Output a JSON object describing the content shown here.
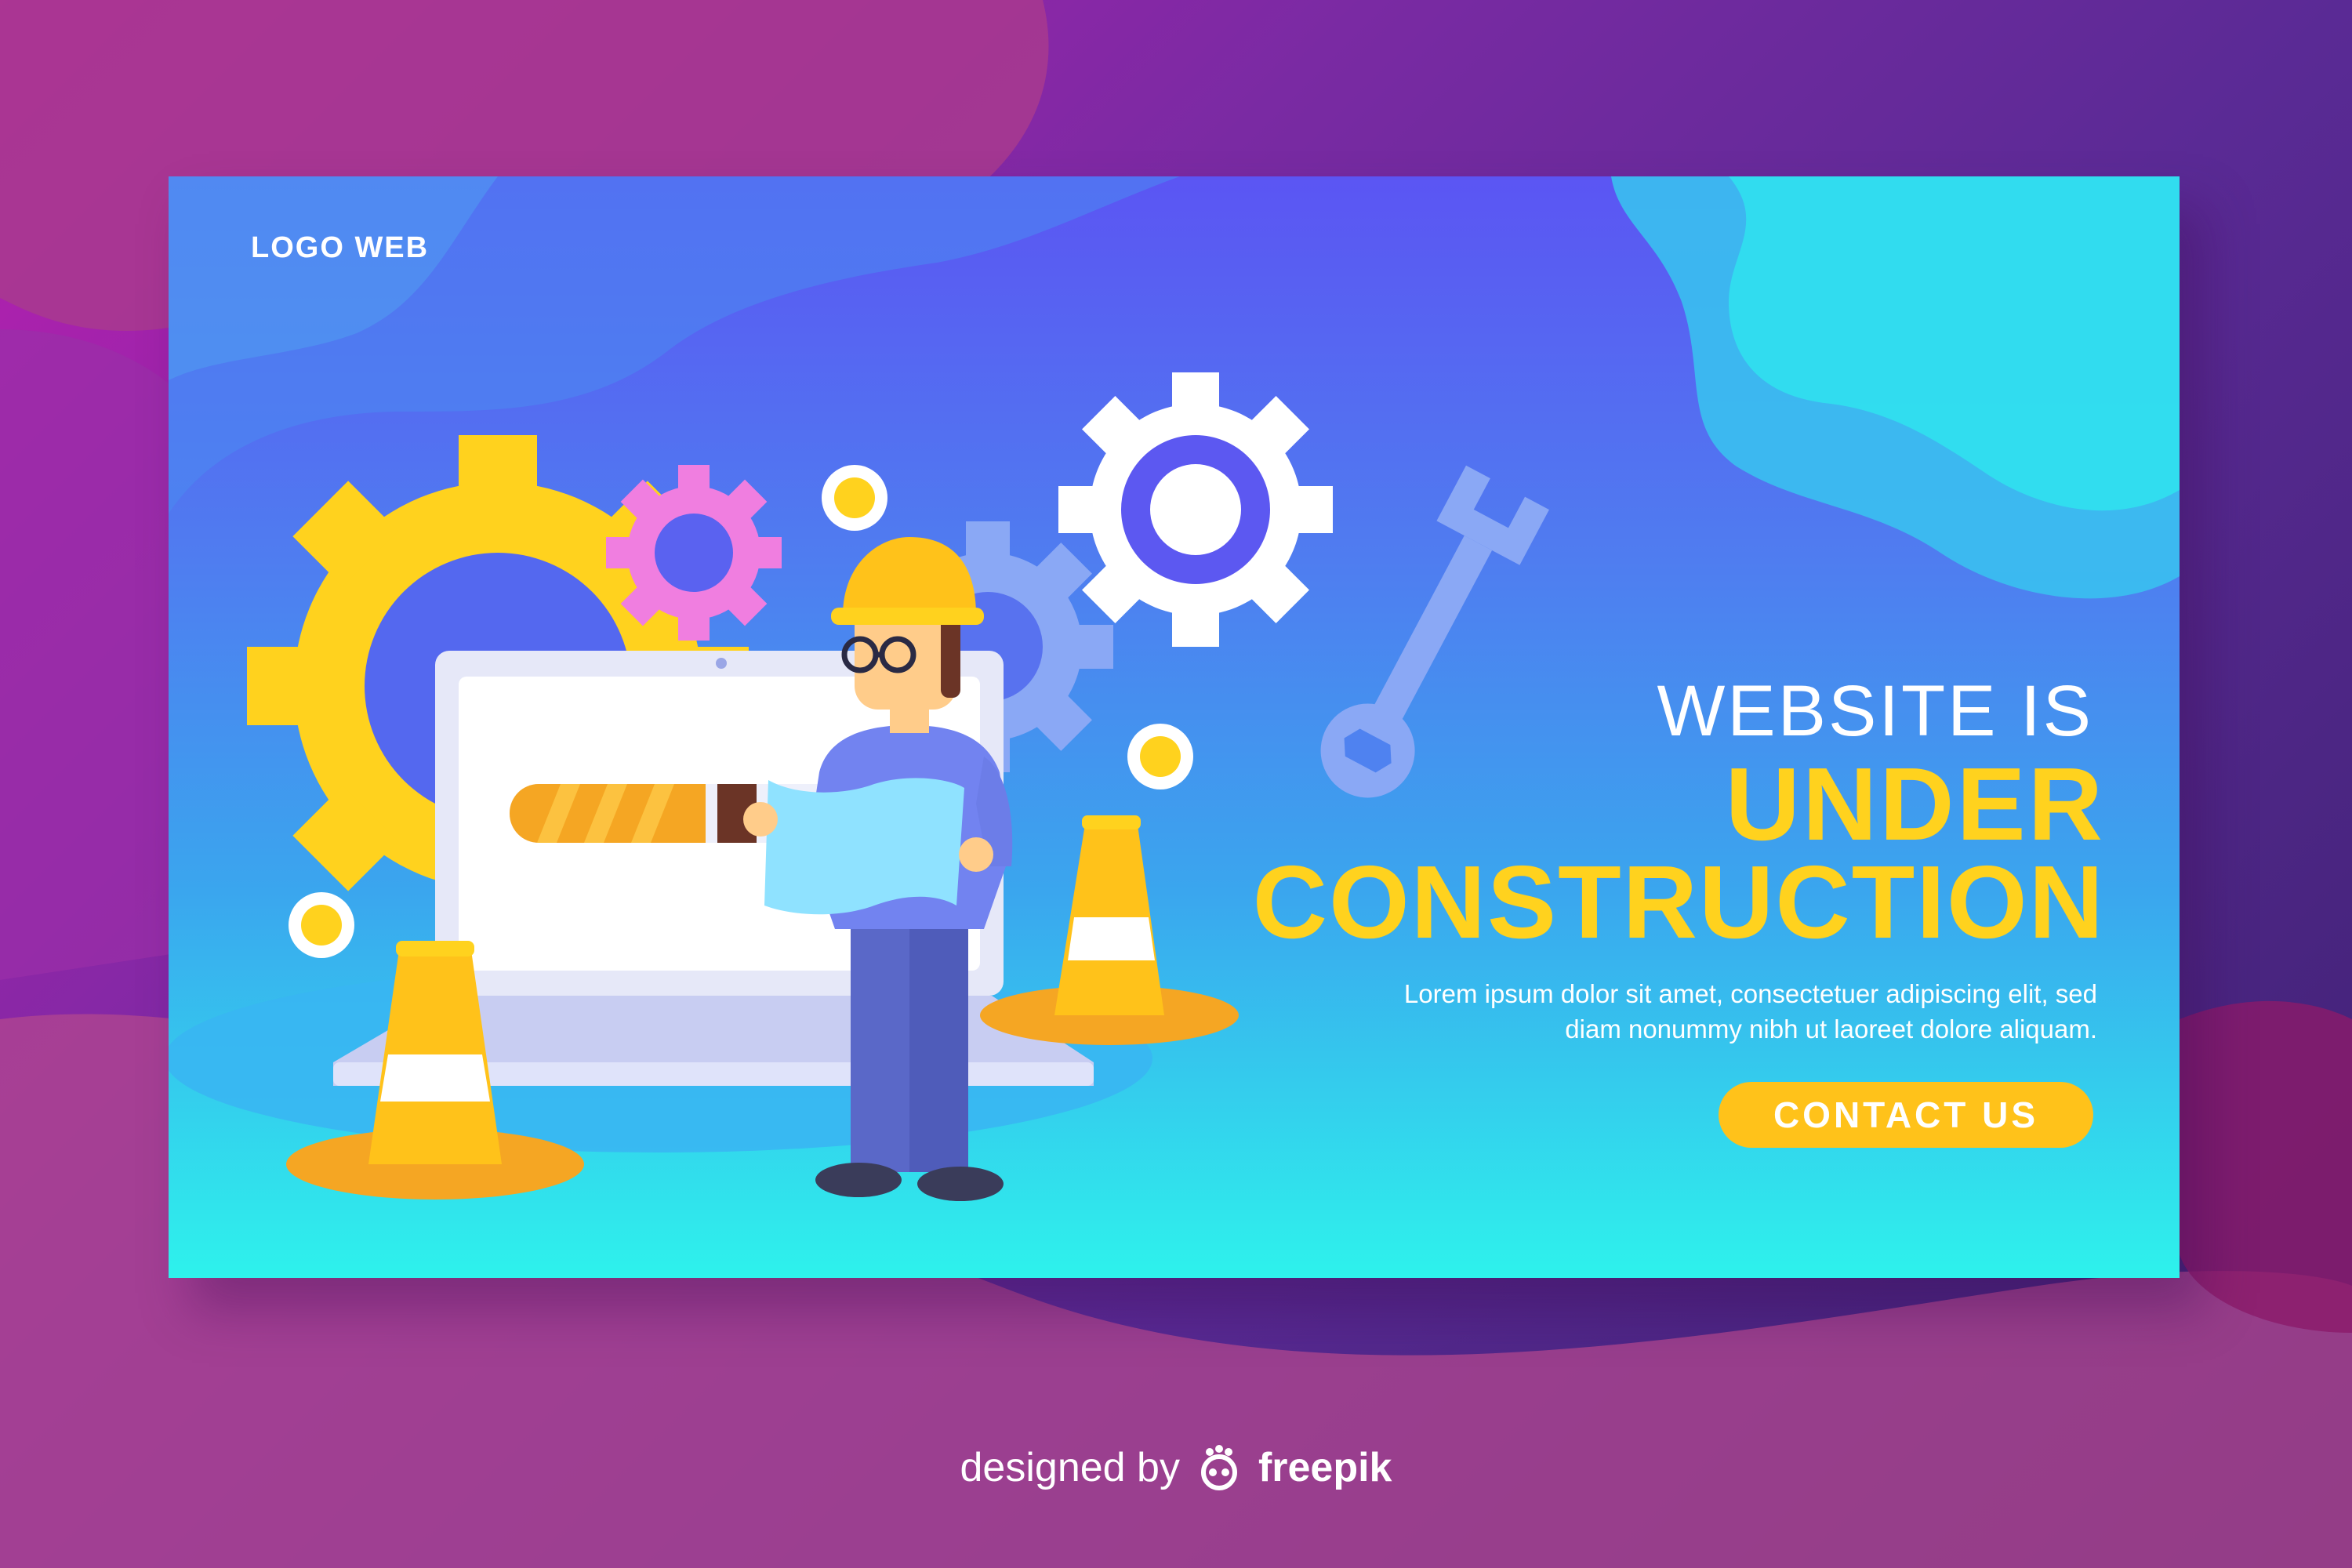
{
  "logo": {
    "text": "LOGO WEB"
  },
  "hero": {
    "line1": "WEBSITE IS",
    "line2": "UNDER",
    "line3": "CONSTRUCTION",
    "description_line1": "Lorem ipsum dolor sit amet, consectetuer adipiscing elit, sed",
    "description_line2": "diam nonummy nibh ut laoreet dolore aliquam.",
    "cta_label": "CONTACT US"
  },
  "progress": {
    "value_percent": 48
  },
  "credit": {
    "prefix": "designed by",
    "brand": "freepik"
  },
  "colors": {
    "accent_yellow": "#ffc21a",
    "headline_yellow": "#ffd21e",
    "gear_pink": "#f07ee0",
    "gear_white": "#ffffff",
    "gear_blue": "#8aa8f5"
  },
  "icons": [
    "gear-icon",
    "wrench-icon",
    "traffic-cone-icon",
    "laptop-icon",
    "freepik-logo-icon"
  ]
}
